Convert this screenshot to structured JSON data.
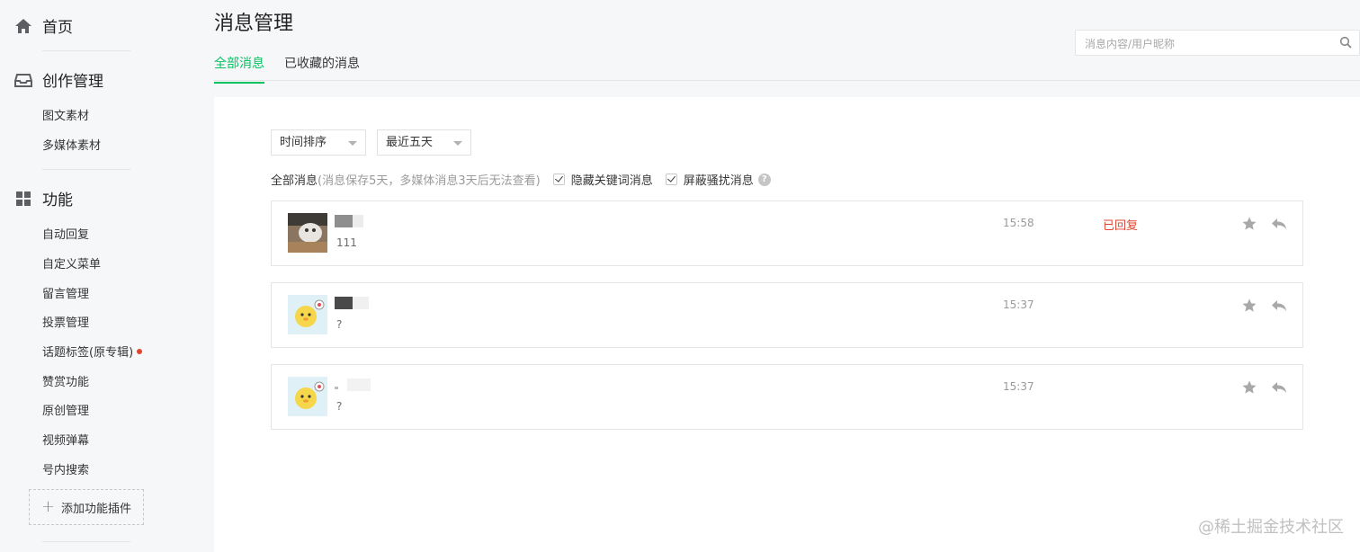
{
  "sidebar": {
    "home": "首页",
    "creation": {
      "title": "创作管理",
      "items": [
        "图文素材",
        "多媒体素材"
      ]
    },
    "features": {
      "title": "功能",
      "items": [
        "自动回复",
        "自定义菜单",
        "留言管理",
        "投票管理",
        "话题标签(原专辑)",
        "赞赏功能",
        "原创管理",
        "视频弹幕",
        "号内搜索"
      ]
    },
    "add_plugin": "添加功能插件"
  },
  "header": {
    "title": "消息管理",
    "tabs": [
      "全部消息",
      "已收藏的消息"
    ],
    "search_placeholder": "消息内容/用户昵称"
  },
  "filters": {
    "sort": "时间排序",
    "range": "最近五天",
    "label": "全部消息",
    "note": "(消息保存5天，多媒体消息3天后无法查看)",
    "hide_keywords": "隐藏关键词消息",
    "block_spam": "屏蔽骚扰消息"
  },
  "messages": [
    {
      "text": "111",
      "time": "15:58",
      "status": "已回复"
    },
    {
      "text": "?",
      "time": "15:37",
      "status": ""
    },
    {
      "text": "?",
      "time": "15:37",
      "status": ""
    }
  ],
  "watermark": "@稀土掘金技术社区",
  "colors": {
    "accent": "#07c160",
    "alert": "#e0452f"
  }
}
